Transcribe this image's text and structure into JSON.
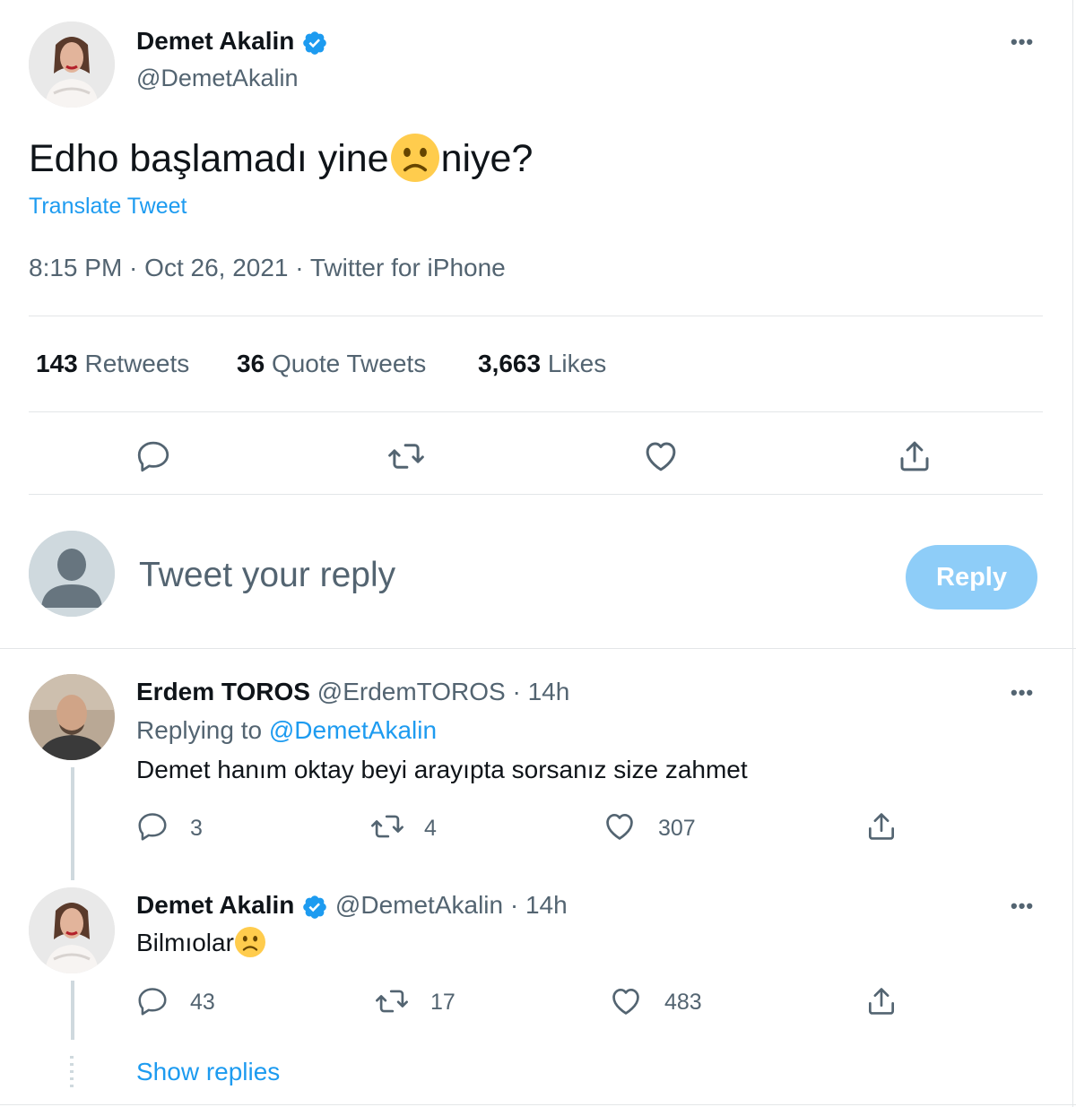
{
  "main_tweet": {
    "author_name": "Demet Akalin",
    "author_handle": "@DemetAkalin",
    "text_before": "Edho başlamadı yine",
    "text_after": "niye?",
    "translate_label": "Translate Tweet",
    "meta": "8:15 PM · Oct 26, 2021 · Twitter for iPhone",
    "stats": {
      "retweets_count": "143",
      "retweets_label": "Retweets",
      "quotes_count": "36",
      "quotes_label": "Quote Tweets",
      "likes_count": "3,663",
      "likes_label": "Likes"
    }
  },
  "composer": {
    "placeholder": "Tweet your reply",
    "reply_label": "Reply"
  },
  "replies": [
    {
      "author_name": "Erdem TOROS",
      "author_handle": "@ErdemTOROS",
      "time": "· 14h",
      "replying_prefix": "Replying to",
      "replying_handle": "@DemetAkalin",
      "text": "Demet hanım oktay beyi arayıpta sorsanız size zahmet",
      "replies": "3",
      "retweets": "4",
      "likes": "307"
    },
    {
      "author_name": "Demet Akalin",
      "author_handle": "@DemetAkalin",
      "time": "· 14h",
      "text": "Bilmıolar",
      "replies": "43",
      "retweets": "17",
      "likes": "483"
    }
  ],
  "show_replies_label": "Show replies",
  "colors": {
    "accent": "#1d9bf0",
    "reply_button_disabled": "#8ecdf8",
    "muted_text": "#536471",
    "emoji_yellow": "#ffcc4d"
  },
  "icons": [
    "verified-badge-icon",
    "more-icon",
    "reply-icon",
    "retweet-icon",
    "like-icon",
    "share-icon",
    "frown-emoji"
  ]
}
